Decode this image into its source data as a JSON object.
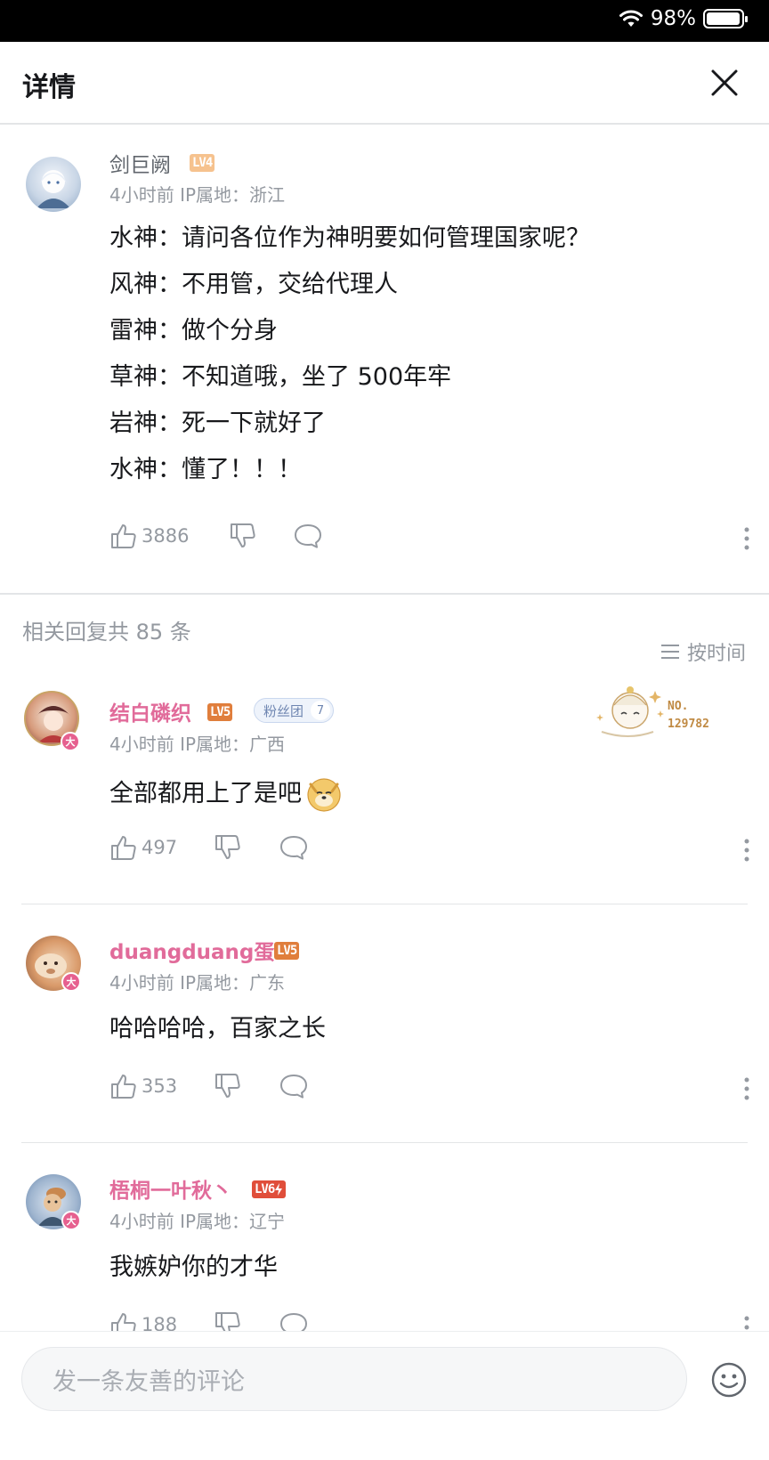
{
  "status_bar": {
    "battery": "98%",
    "battery_level": 0.98
  },
  "header": {
    "title": "详情",
    "close_icon": "close-icon"
  },
  "main_comment": {
    "username": "剑巨阙",
    "level": "LV4",
    "meta": "4小时前  IP属地：浙江",
    "lines": [
      "水神：请问各位作为神明要如何管理国家呢？",
      "风神：不用管，交给代理人",
      "雷神：做个分身",
      "草神：不知道哦，坐了 500年牢",
      "岩神：死一下就好了",
      "水神：懂了！！！"
    ],
    "likes": "3886"
  },
  "replies_section": {
    "title": "相关回复共 85 条",
    "sort_label": "按时间"
  },
  "decoration": {
    "line1": "NO.",
    "line2": "129782"
  },
  "replies": [
    {
      "username": "结白磷织",
      "level": "LV5",
      "fan_badge": {
        "name": "粉丝团",
        "level": "7"
      },
      "meta": "4小时前  IP属地：广西",
      "content": "全部都用上了是吧",
      "likes": "497",
      "avatar_badge": "大"
    },
    {
      "username": "duangduang蛋",
      "level": "LV5",
      "meta": "4小时前  IP属地：广东",
      "content": "哈哈哈哈，百家之长",
      "likes": "353",
      "avatar_badge": "大"
    },
    {
      "username": "梧桐一叶秋丶",
      "level": "LV6",
      "meta": "4小时前  IP属地：辽宁",
      "content": "我嫉妒你的才华",
      "likes": "188",
      "avatar_badge": "大"
    }
  ],
  "bottom_bar": {
    "placeholder": "发一条友善的评论"
  },
  "colors": {
    "accent_pink": "#e16b9a",
    "lv4": "#f6c28e",
    "lv5": "#e07e3c",
    "lv6": "#e04e3a"
  }
}
